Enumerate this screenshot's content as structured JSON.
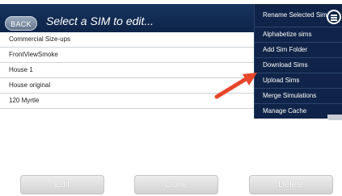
{
  "header": {
    "back_label": "BACK",
    "title": "Select a SIM to edit..."
  },
  "sims": [
    "Commercial Size-ups",
    "FrontViewSmoke",
    "House 1",
    "House original",
    "120 Myrtle"
  ],
  "menu": {
    "items": [
      "Rename Selected Sim",
      "Alphabetize sims",
      "Add Sim Folder",
      "Download Sims",
      "Upload Sims",
      "Merge Simulations",
      "Manage Cache"
    ],
    "icon": "hamburger-circle-icon",
    "highlighted_item": "Upload Sims"
  },
  "annotation": {
    "icon": "red-arrow-icon",
    "color": "#e8472c",
    "points_to": "Upload Sims"
  },
  "buttons": {
    "edit_label": "Edit",
    "clone_label": "Clone",
    "delete_label": "Delete"
  },
  "colors": {
    "header_bg": "#132c55",
    "menu_bg": "#0f2448",
    "arrow": "#e8472c"
  }
}
